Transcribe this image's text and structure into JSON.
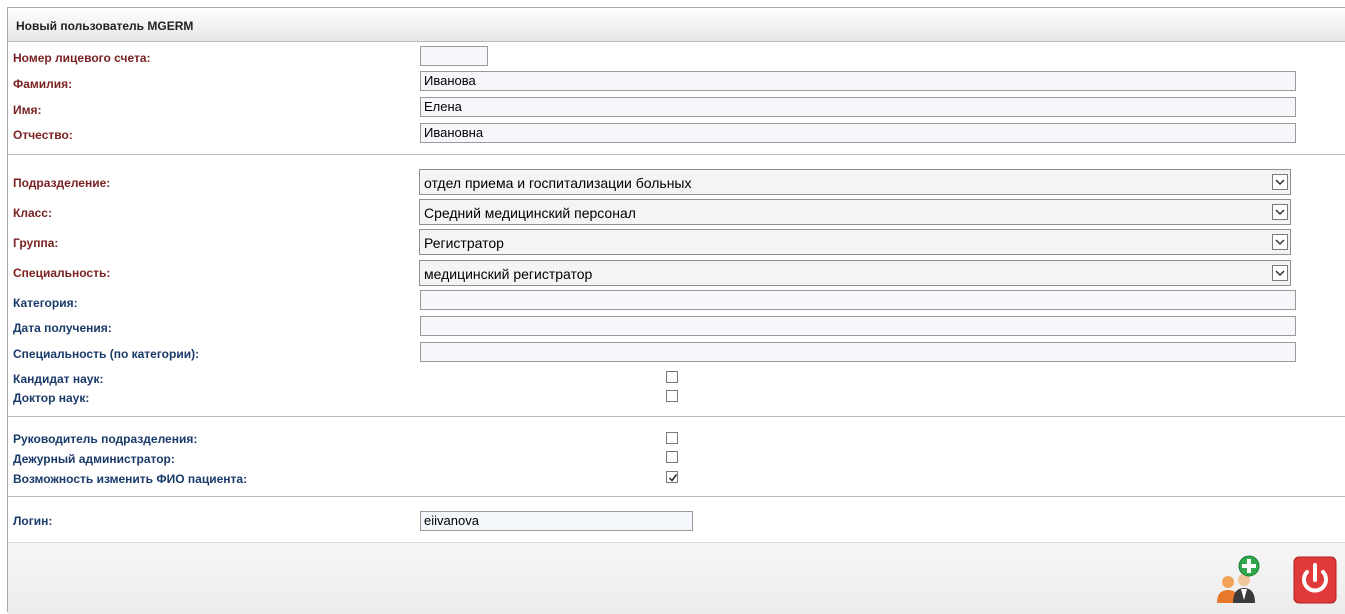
{
  "window": {
    "title": "Новый пользователь MGERM"
  },
  "form": {
    "account_label": "Номер лицевого счета:",
    "account_value": "",
    "lastname_label": "Фамилия:",
    "lastname_value": "Иванова",
    "firstname_label": "Имя:",
    "firstname_value": "Елена",
    "patronymic_label": "Отчество:",
    "patronymic_value": "Ивановна",
    "department_label": "Подразделение:",
    "department_value": "отдел приема и госпитализации больных",
    "class_label": "Класс:",
    "class_value": "Средний медицинский персонал",
    "group_label": "Группа:",
    "group_value": "Регистратор",
    "specialty_label": "Специальность:",
    "specialty_value": "медицинский регистратор",
    "category_label": "Категория:",
    "category_value": "",
    "date_label": "Дата получения:",
    "date_value": "",
    "cat_specialty_label": "Специальность (по категории):",
    "cat_specialty_value": "",
    "candidate_label": "Кандидат наук:",
    "candidate_checked": false,
    "doctor_label": "Доктор наук:",
    "doctor_checked": false,
    "head_label": "Руководитель подразделения:",
    "head_checked": false,
    "duty_admin_label": "Дежурный администратор:",
    "duty_admin_checked": false,
    "change_fio_label": "Возможность изменить ФИО пациента:",
    "change_fio_checked": true,
    "login_label": "Логин:",
    "login_value": "eiivanova"
  },
  "footer": {
    "add_user_icon": "add-user-icon",
    "power_icon": "power-icon",
    "power_color": "#e03a3a",
    "add_color": "#2ea84a"
  }
}
